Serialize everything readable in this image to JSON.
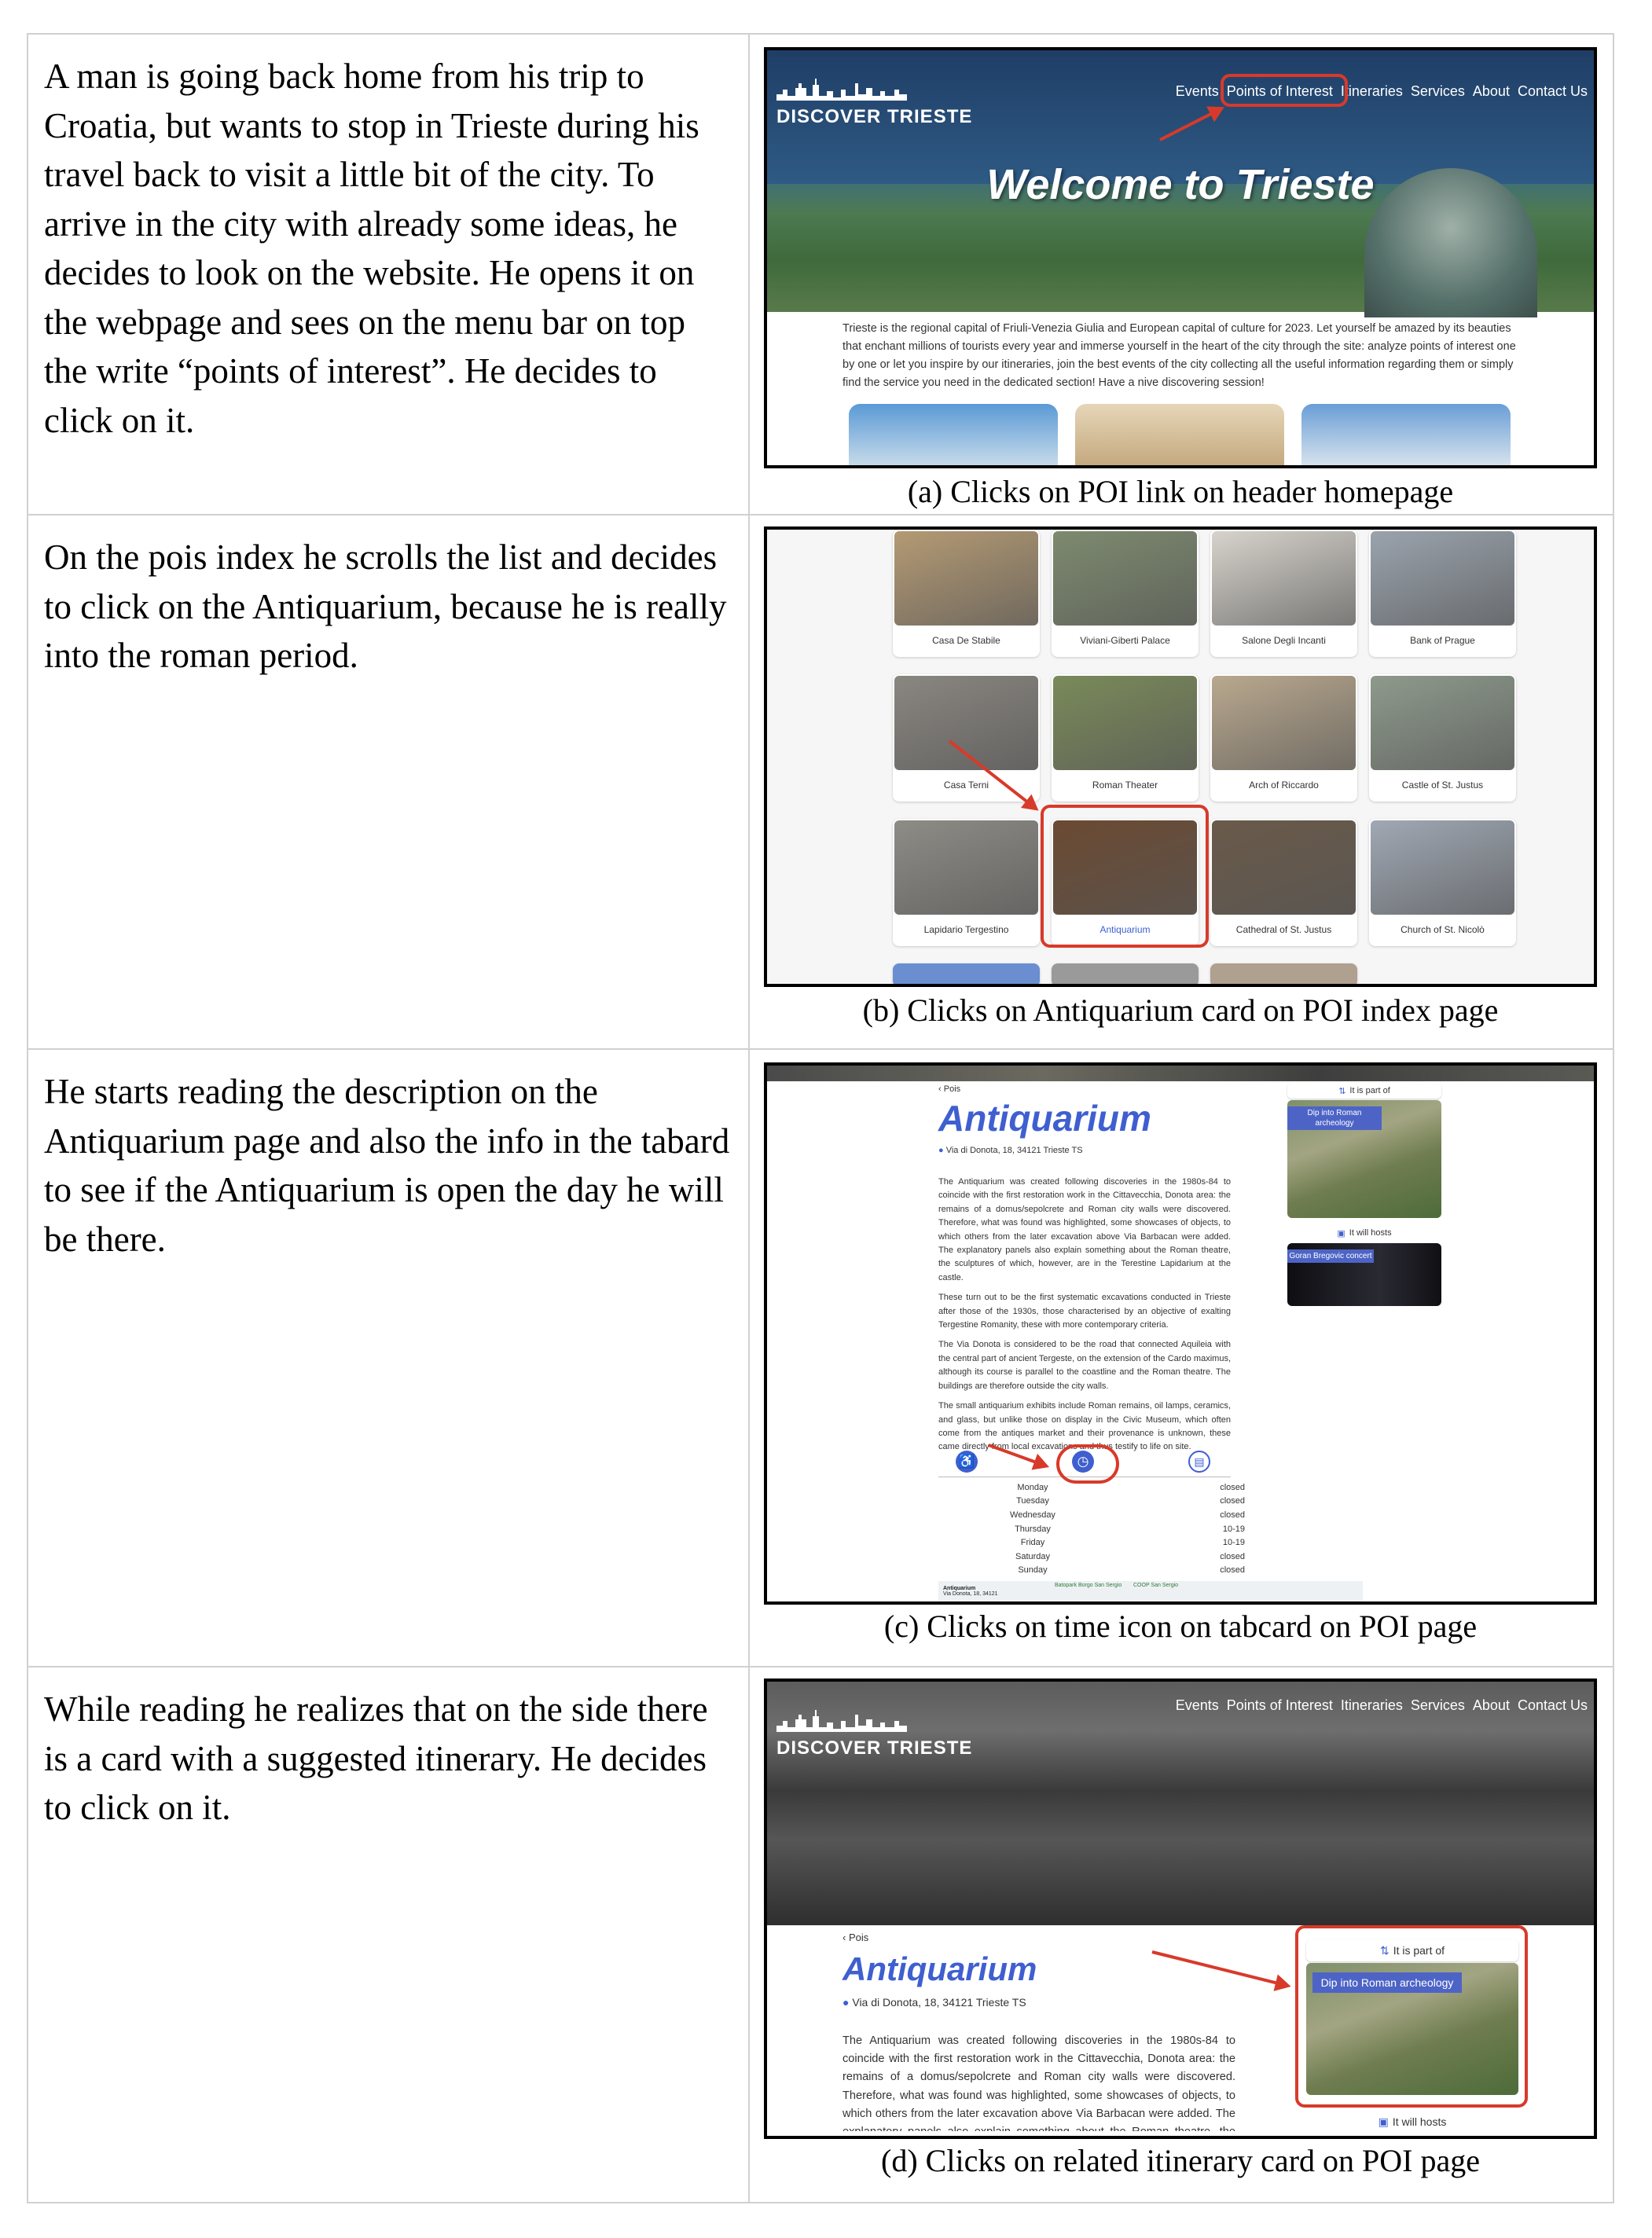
{
  "rows": [
    {
      "narrative": "A man is going back home from his trip to Croatia, but wants to stop in Trieste during his travel back to visit a little bit of the city. To arrive in the city with already some ideas, he decides to look on the website. He opens it on the webpage and sees on the menu bar on top the write “points of interest”. He decides to click on it.",
      "caption": "(a) Clicks on POI link on header homepage"
    },
    {
      "narrative": "On the pois index he scrolls the list and decides to click on the Antiquarium, because he is really into the roman period.",
      "caption": "(b) Clicks on Antiquarium card on POI index page"
    },
    {
      "narrative": "He starts reading the description on the Antiquarium page and also the info in the tabard to see if the Antiquarium is open the day he will be there.",
      "caption": "(c) Clicks on time icon on tabcard on POI page"
    },
    {
      "narrative": "While reading he realizes that on the side there is a card with a suggested itinerary. He decides to click on it.",
      "caption": "(d) Clicks on related itinerary card on POI page"
    }
  ],
  "site": {
    "logo": "Discover Trieste",
    "nav": [
      "Events",
      "Points of Interest",
      "Itineraries",
      "Services",
      "About",
      "Contact Us"
    ],
    "welcome": "Welcome to Trieste",
    "intro": "Trieste is the regional capital of Friuli-Venezia Giulia and European capital of culture for 2023. Let yourself be amazed by its beauties that enchant millions of tourists every year and immerse yourself in the heart of the city through the site: analyze points of interest one by one or let you inspire by our itineraries, join the best events of the city collecting all the useful information regarding them or simply find the service you need in the dedicated section! Have a nive discovering session!"
  },
  "poi_index": {
    "cards": [
      {
        "label": "Casa De Stabile",
        "color": "#b49a74"
      },
      {
        "label": "Viviani-Giberti Palace",
        "color": "#7d8a6e"
      },
      {
        "label": "Salone Degli Incanti",
        "color": "#d7d3cc"
      },
      {
        "label": "Bank of Prague",
        "color": "#9aa3ad"
      },
      {
        "label": "Casa Terni",
        "color": "#8a8680"
      },
      {
        "label": "Roman Theater",
        "color": "#7a8a5a"
      },
      {
        "label": "Arch of Riccardo",
        "color": "#b9a88e"
      },
      {
        "label": "Castle of St. Justus",
        "color": "#8e9a8c"
      },
      {
        "label": "Lapidario Tergestino",
        "color": "#8e8c86"
      },
      {
        "label": "Antiquarium",
        "color": "#6b4a32"
      },
      {
        "label": "Cathedral of St. Justus",
        "color": "#6a5a4a"
      },
      {
        "label": "Church of St. Nicolò",
        "color": "#a0a8b4"
      }
    ]
  },
  "poi_page": {
    "back": "Pois",
    "title": "Antiquarium",
    "address": "Via di Donota, 18, 34121 Trieste TS",
    "paragraphs": [
      "The Antiquarium was created following discoveries in the 1980s-84 to coincide with the first restoration work in the Cittavecchia, Donota area: the remains of a domus/sepolcrete and Roman city walls were discovered. Therefore, what was found was highlighted, some showcases of objects, to which others from the later excavation above Via Barbacan were added. The explanatory panels also explain something about the Roman theatre, the sculptures of which, however, are in the Terestine Lapidarium at the castle.",
      "These turn out to be the first systematic excavations conducted in Trieste after those of the 1930s, those characterised by an objective of exalting Tergestine Romanity, these with more contemporary criteria.",
      "The Via Donota is considered to be the road that connected Aquileia with the central part of ancient Tergeste, on the extension of the Cardo maximus, although its course is parallel to the coastline and the Roman theatre. The buildings are therefore outside the city walls.",
      "The small antiquarium exhibits include Roman remains, oil lamps, ceramics, and glass, but unlike those on display in the Civic Museum, which often come from the antiques market and their provenance is unknown, these came directly from local excavations and thus testify to life on site."
    ],
    "part_of": "It is part of",
    "itinerary": "Dip into Roman archeology",
    "hosts": "It will hosts",
    "event": "Goran Bregovic concert",
    "hours": [
      {
        "day": "Monday",
        "status": "closed"
      },
      {
        "day": "Tuesday",
        "status": "closed"
      },
      {
        "day": "Wednesday",
        "status": "closed"
      },
      {
        "day": "Thursday",
        "status": "10-19"
      },
      {
        "day": "Friday",
        "status": "10-19"
      },
      {
        "day": "Saturday",
        "status": "closed"
      },
      {
        "day": "Sunday",
        "status": "closed"
      }
    ],
    "map_label": "Antiquarium",
    "map_sub": "Via Donota, 18, 34121",
    "map_poi1": "Batopark Borgo San Sergio",
    "map_poi2": "COOP San Sergio"
  },
  "colors": {
    "accent": "#3f5fd0",
    "highlight": "#d83a2a"
  }
}
